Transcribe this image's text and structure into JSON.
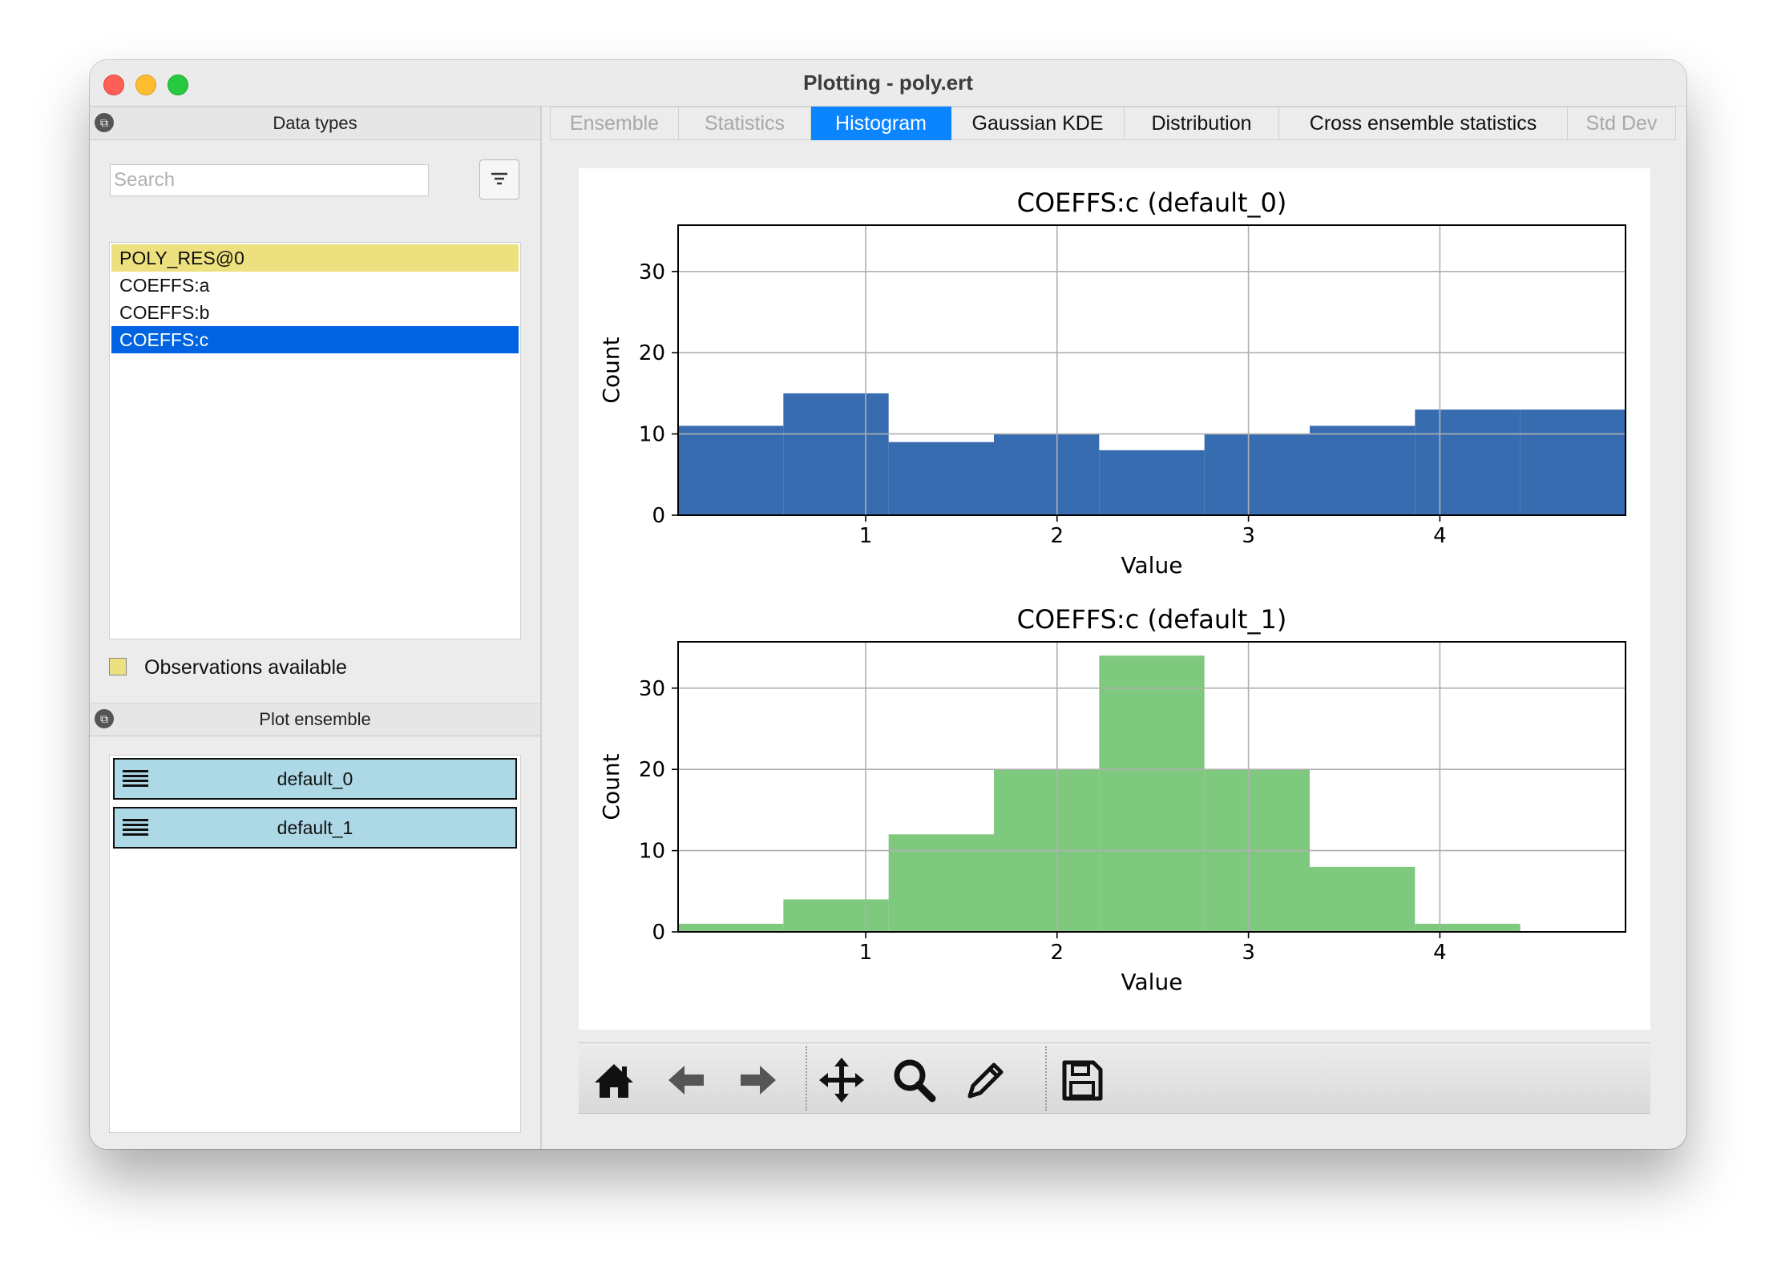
{
  "window": {
    "title": "Plotting - poly.ert"
  },
  "data_types": {
    "header": "Data types",
    "search_placeholder": "Search",
    "items": [
      {
        "label": "POLY_RES@0",
        "state": "observations"
      },
      {
        "label": "COEFFS:a",
        "state": "normal"
      },
      {
        "label": "COEFFS:b",
        "state": "normal"
      },
      {
        "label": "COEFFS:c",
        "state": "selected"
      }
    ],
    "observations_legend": "Observations available",
    "observations_color": "#ede07f",
    "selected_color": "#0063e1"
  },
  "plot_ensemble": {
    "header": "Plot ensemble",
    "items": [
      {
        "label": "default_0"
      },
      {
        "label": "default_1"
      }
    ],
    "item_color": "#add8e6"
  },
  "tabs": [
    {
      "label": "Ensemble",
      "state": "disabled"
    },
    {
      "label": "Statistics",
      "state": "disabled"
    },
    {
      "label": "Histogram",
      "state": "active"
    },
    {
      "label": "Gaussian KDE",
      "state": "normal"
    },
    {
      "label": "Distribution",
      "state": "normal"
    },
    {
      "label": "Cross ensemble statistics",
      "state": "normal"
    },
    {
      "label": "Std Dev",
      "state": "disabled"
    }
  ],
  "toolbar": {
    "icons": [
      "home-icon",
      "back-arrow-icon",
      "forward-arrow-icon",
      "pan-move-icon",
      "zoom-magnifier-icon",
      "edit-pencil-icon",
      "save-floppy-icon"
    ]
  },
  "chart_data": [
    {
      "type": "bar",
      "title": "COEFFS:c (default_0)",
      "xlabel": "Value",
      "ylabel": "Count",
      "color": "#386cb0",
      "bin_edges": [
        0.02,
        0.57,
        1.12,
        1.67,
        2.22,
        2.77,
        3.32,
        3.87,
        4.42,
        4.97
      ],
      "values": [
        11,
        15,
        9,
        10,
        8,
        10,
        11,
        13,
        13
      ],
      "xlim": [
        0.02,
        4.97
      ],
      "ylim": [
        0,
        35.7
      ],
      "xticks": [
        1,
        2,
        3,
        4
      ],
      "yticks": [
        0,
        10,
        20,
        30
      ],
      "grid": true
    },
    {
      "type": "bar",
      "title": "COEFFS:c (default_1)",
      "xlabel": "Value",
      "ylabel": "Count",
      "color": "#7fc97f",
      "bin_edges": [
        0.02,
        0.57,
        1.12,
        1.67,
        2.22,
        2.77,
        3.32,
        3.87,
        4.42,
        4.97
      ],
      "values": [
        1,
        4,
        12,
        20,
        34,
        20,
        8,
        1,
        0
      ],
      "xlim": [
        0.02,
        4.97
      ],
      "ylim": [
        0,
        35.7
      ],
      "xticks": [
        1,
        2,
        3,
        4
      ],
      "yticks": [
        0,
        10,
        20,
        30
      ],
      "grid": true
    }
  ]
}
